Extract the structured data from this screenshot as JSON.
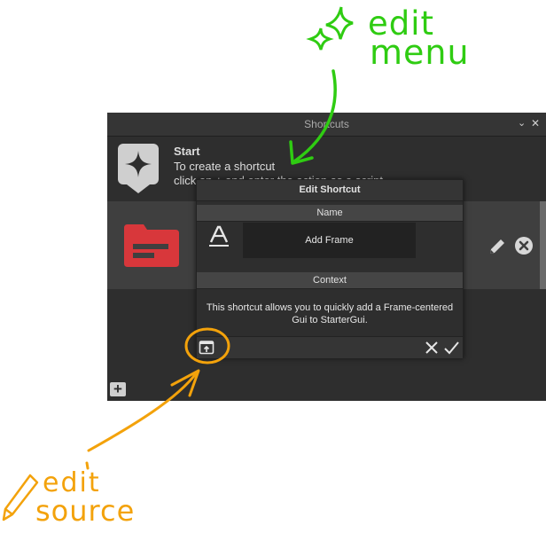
{
  "annotations": {
    "edit_menu_note": [
      "edit",
      "menu"
    ],
    "edit_source_note": [
      "edit",
      "source"
    ]
  },
  "panel": {
    "title": "Shortcuts",
    "start": {
      "title": "Start",
      "line1": "To create a shortcut",
      "line2": "click on  +  and enter the action as a script"
    }
  },
  "modal": {
    "title": "Edit Shortcut",
    "name_label": "Name",
    "name_value": "Add Frame",
    "context_label": "Context",
    "description_line1": "This shortcut allows you to quickly add a Frame-centered",
    "description_line2": "Gui to StarterGui."
  },
  "icons": {
    "start": "sparkle-icon",
    "item": "folder-icon",
    "edit": "pencil-icon",
    "delete": "close-circle-icon",
    "text": "text-icon",
    "edit_source": "open-source-icon",
    "cancel": "close-icon",
    "confirm": "check-icon",
    "add": "plus-icon"
  },
  "colors": {
    "annotation_green": "#2fcc12",
    "annotation_orange": "#f3a20b",
    "folder_red": "#d8373b",
    "panel_bg": "#2e2e2e"
  }
}
